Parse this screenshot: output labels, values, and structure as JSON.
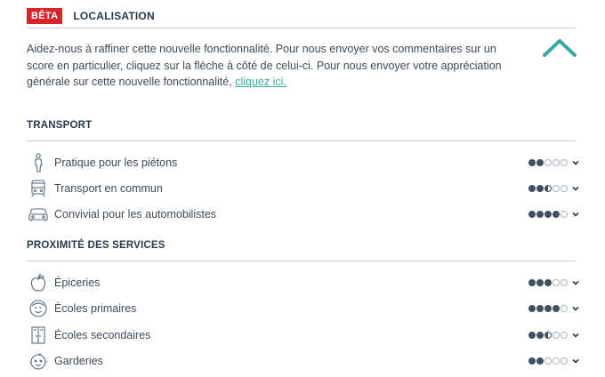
{
  "header": {
    "badge": "BÊTA",
    "title": "LOCALISATION"
  },
  "intro": {
    "text": "Aidez-nous à raffiner cette nouvelle fonctionnalité. Pour nous envoyer vos commentaires sur un score en particulier, cliquez sur la flèche à côté de celui-ci. Pour nous envoyer votre appréciation générale sur cette nouvelle fonctionnalité, ",
    "link": "cliquez ici."
  },
  "colors": {
    "accent": "#3aa9a3",
    "badge": "#d8252b",
    "dot_fill": "#3e5060",
    "dot_empty": "#a9b4bf"
  },
  "sections": [
    {
      "title": "TRANSPORT",
      "items": [
        {
          "label": "Pratique pour les piétons",
          "icon": "pedestrian-icon",
          "score": 2
        },
        {
          "label": "Transport en commun",
          "icon": "bus-icon",
          "score": 2.5
        },
        {
          "label": "Convivial pour les automobilistes",
          "icon": "car-icon",
          "score": 4
        }
      ]
    },
    {
      "title": "PROXIMITÉ DES SERVICES",
      "items": [
        {
          "label": "Épiceries",
          "icon": "apple-icon",
          "score": 3
        },
        {
          "label": "Écoles primaires",
          "icon": "child-face-icon",
          "score": 4
        },
        {
          "label": "Écoles secondaires",
          "icon": "locker-icon",
          "score": 2.5
        },
        {
          "label": "Garderies",
          "icon": "baby-face-icon",
          "score": 2
        }
      ]
    }
  ]
}
